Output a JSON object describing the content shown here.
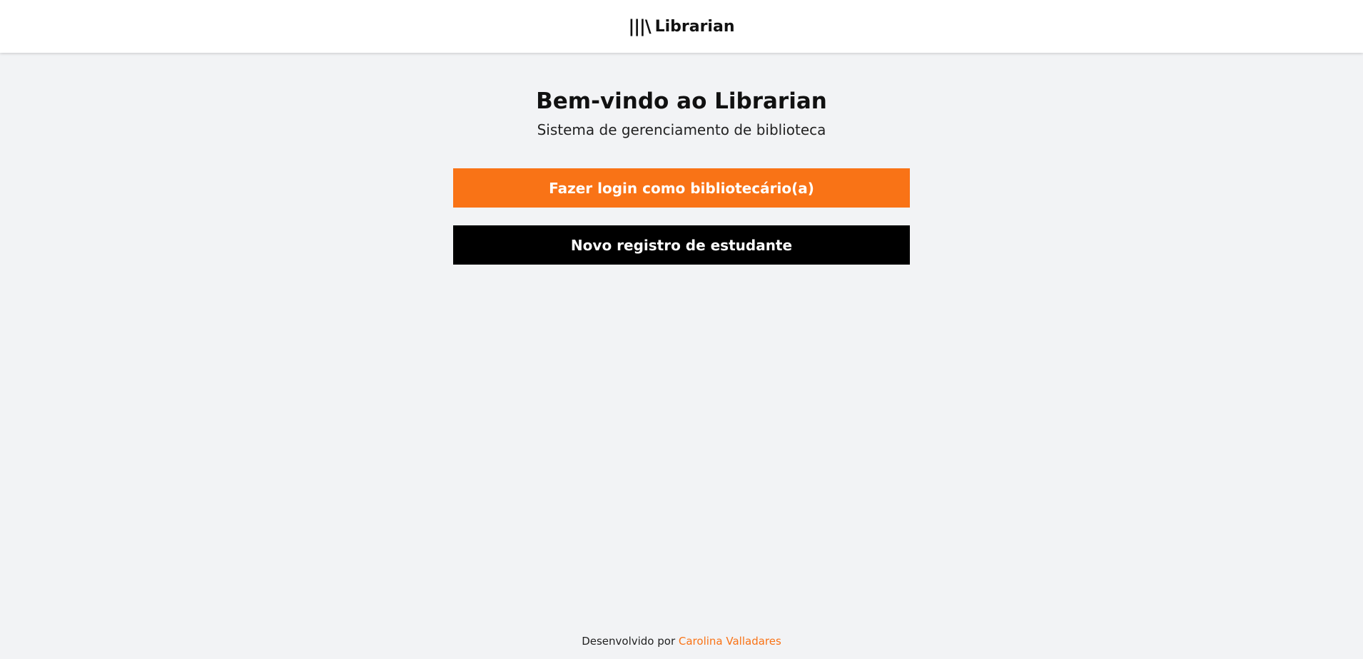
{
  "header": {
    "brand_icon": "|||\\",
    "brand_name": "Librarian"
  },
  "main": {
    "title": "Bem-vindo ao Librarian",
    "subtitle": "Sistema de gerenciamento de biblioteca",
    "login_button_label": "Fazer login como bibliotecário(a)",
    "register_button_label": "Novo registro de estudante"
  },
  "footer": {
    "prefix": "Desenvolvido por",
    "author": "Carolina Valladares"
  },
  "colors": {
    "accent": "#f97316",
    "primary_dark": "#000000",
    "background": "#f2f3f5",
    "header_background": "#ffffff"
  }
}
